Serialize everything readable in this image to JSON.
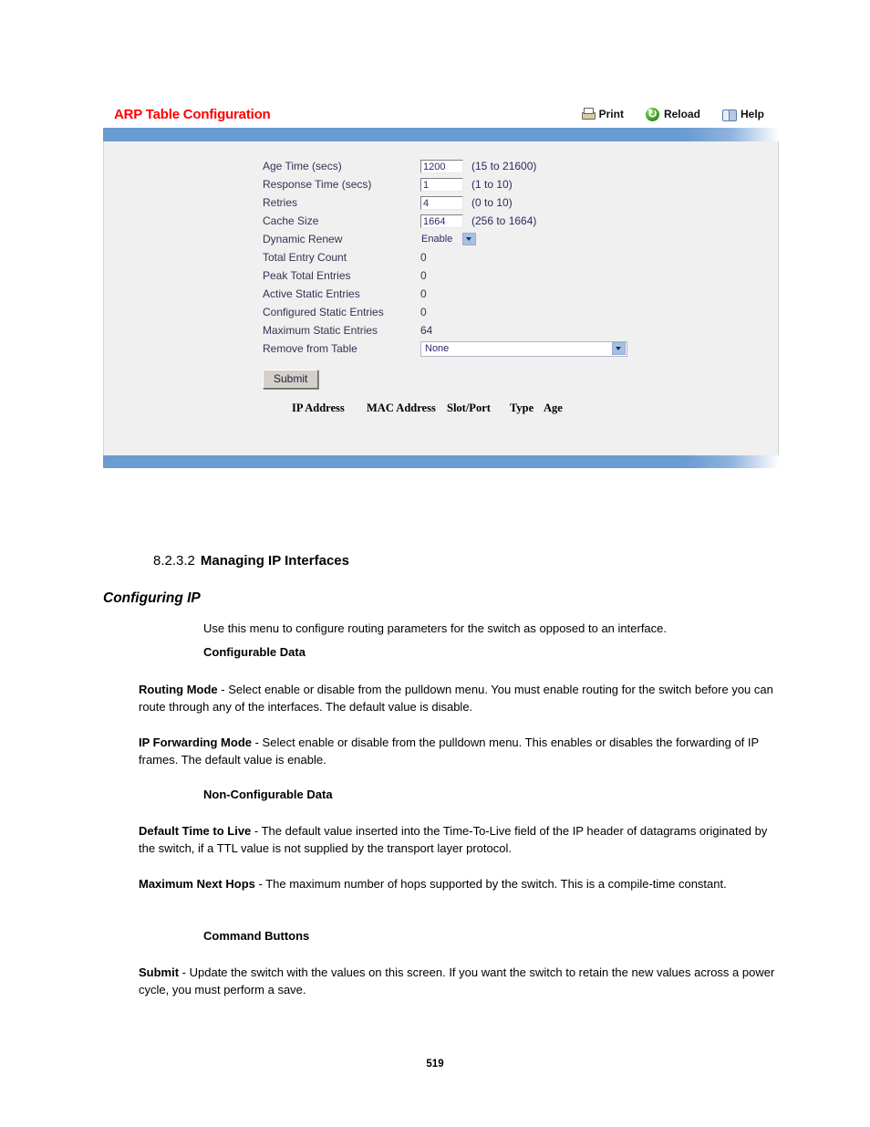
{
  "screenshot": {
    "title": "ARP Table Configuration",
    "toolbar": [
      {
        "label": "Print",
        "icon": "printer-icon"
      },
      {
        "label": "Reload",
        "icon": "reload-icon"
      },
      {
        "label": "Help",
        "icon": "help-book-icon"
      }
    ],
    "fields": [
      {
        "label": "Age Time (secs)",
        "type": "text",
        "value": "1200",
        "hint": "(15 to 21600)"
      },
      {
        "label": "Response Time (secs)",
        "type": "text",
        "value": "1",
        "hint": "(1 to 10)"
      },
      {
        "label": "Retries",
        "type": "text",
        "value": "4",
        "hint": "(0 to 10)"
      },
      {
        "label": "Cache Size",
        "type": "text",
        "value": "1664",
        "hint": "(256 to 1664)"
      },
      {
        "label": "Dynamic Renew",
        "type": "select-small",
        "value": "Enable",
        "hint": ""
      },
      {
        "label": "Total Entry Count",
        "type": "static",
        "value": "0",
        "hint": ""
      },
      {
        "label": "Peak Total Entries",
        "type": "static",
        "value": "0",
        "hint": ""
      },
      {
        "label": "Active Static Entries",
        "type": "static",
        "value": "0",
        "hint": ""
      },
      {
        "label": "Configured Static Entries",
        "type": "static",
        "value": "0",
        "hint": ""
      },
      {
        "label": "Maximum Static Entries",
        "type": "static",
        "value": "64",
        "hint": ""
      },
      {
        "label": "Remove from Table",
        "type": "select-wide",
        "value": "None",
        "hint": ""
      }
    ],
    "submit_label": "Submit",
    "table_headers": [
      "IP Address",
      "MAC Address",
      "Slot/Port",
      "Type",
      "Age"
    ],
    "colors": {
      "title_red": "#ff0000",
      "bar_blue": "#6a9bd1",
      "body_gray": "#f0f0f0",
      "input_text": "#2a2a6a"
    }
  },
  "document": {
    "section_number": "8.2.3.2",
    "section_title": "Managing IP Interfaces",
    "subsection_title": "Configuring IP",
    "intro": "Use this menu to configure routing parameters for the switch as opposed to an interface.",
    "configurable_heading": "Configurable Data",
    "routing_mode_term": "Routing Mode",
    "routing_mode_desc": " - Select enable or disable from the pulldown menu. You must enable routing for the switch before you can route through any of the interfaces. The default value is disable.",
    "ip_forwarding_term": "IP Forwarding Mode",
    "ip_forwarding_desc": " - Select enable or disable from the pulldown menu. This enables or disables the forwarding of IP frames. The default value is enable.",
    "nonconfigurable_heading": "Non-Configurable Data",
    "ttl_term": "Default Time to Live",
    "ttl_desc": " - The default value inserted into the Time-To-Live field of the IP header of datagrams originated by the switch, if a TTL value is not supplied by the transport layer protocol.",
    "hops_term": "Maximum Next Hops",
    "hops_desc": " - The maximum number of hops supported by the switch. This is a compile-time constant.",
    "command_buttons_heading": "Command Buttons",
    "submit_term": "Submit",
    "submit_desc": " - Update the switch with the values on this screen. If you want the switch to retain the new values across a power cycle, you must perform a save.",
    "page_number": "519"
  }
}
